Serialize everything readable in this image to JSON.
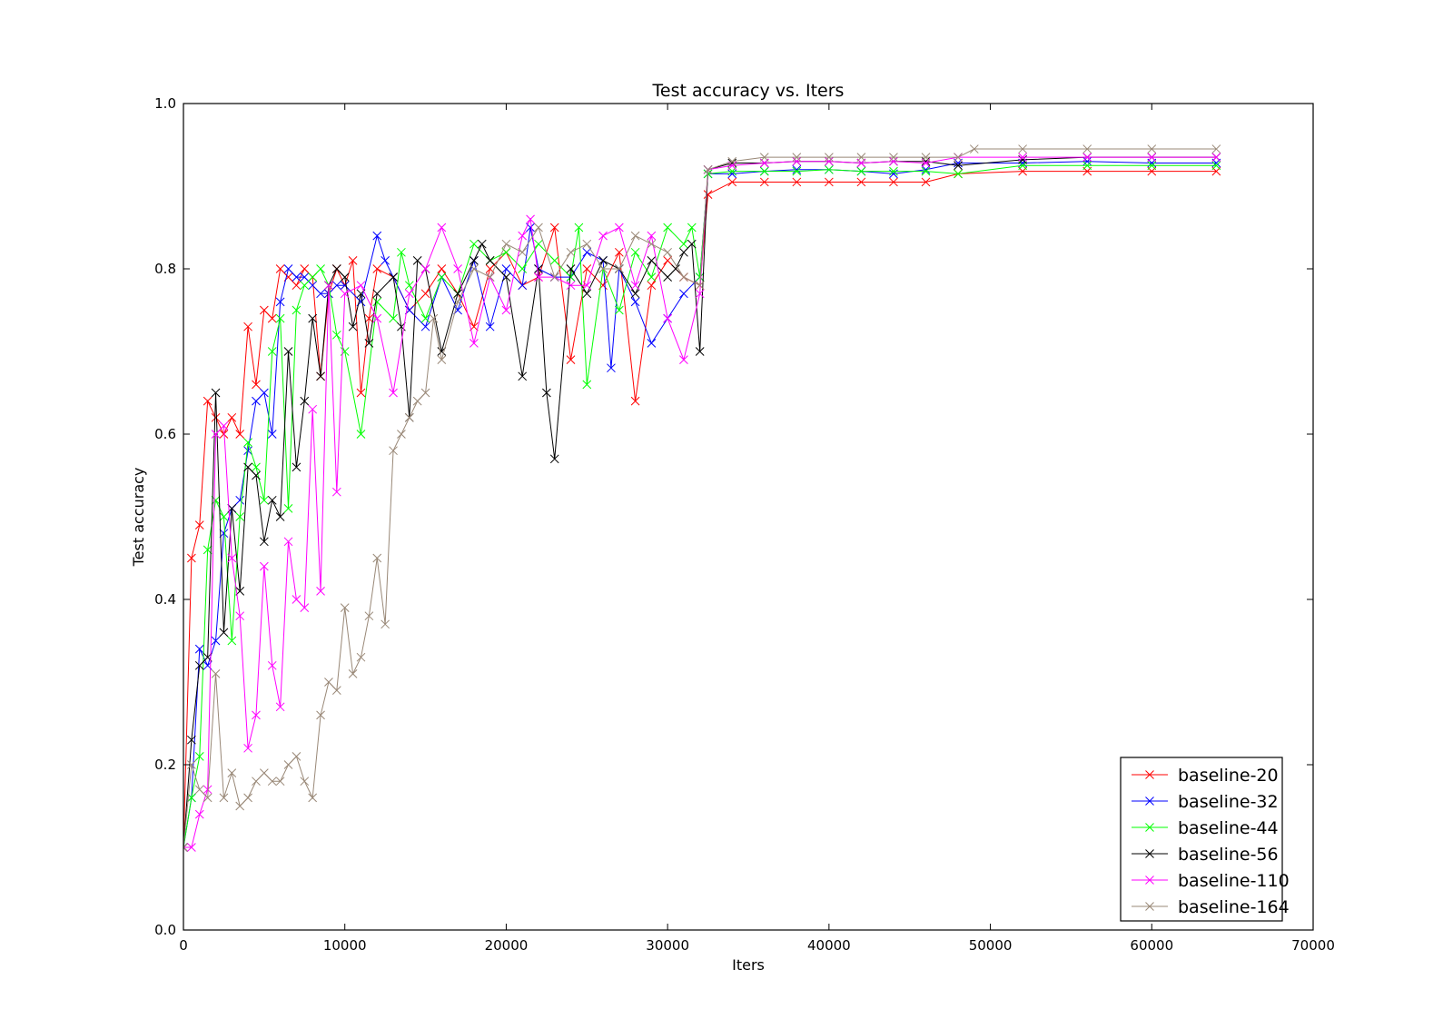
{
  "chart_data": {
    "type": "line",
    "title": "Test accuracy  vs. Iters",
    "xlabel": "Iters",
    "ylabel": "Test accuracy",
    "xlim": [
      0,
      70000
    ],
    "ylim": [
      0.0,
      1.0
    ],
    "xticks": [
      0,
      10000,
      20000,
      30000,
      40000,
      50000,
      60000,
      70000
    ],
    "xtick_labels": [
      "0",
      "10000",
      "20000",
      "30000",
      "40000",
      "50000",
      "60000",
      "70000"
    ],
    "yticks": [
      0.0,
      0.2,
      0.4,
      0.6,
      0.8,
      1.0
    ],
    "ytick_labels": [
      "0.0",
      "0.2",
      "0.4",
      "0.6",
      "0.8",
      "1.0"
    ],
    "grid": false,
    "legend_position": "lower-right",
    "marker": "x",
    "series": [
      {
        "name": "baseline-20",
        "color": "#ff0000",
        "x": [
          0,
          500,
          1000,
          1500,
          2000,
          2500,
          3000,
          3500,
          4000,
          4500,
          5000,
          5500,
          6000,
          6500,
          7000,
          7500,
          8000,
          8500,
          9000,
          9500,
          10000,
          10500,
          11000,
          11500,
          12000,
          13000,
          14000,
          15000,
          16000,
          17000,
          18000,
          19000,
          20000,
          21000,
          22000,
          23000,
          24000,
          25000,
          26000,
          27000,
          28000,
          29000,
          30000,
          31000,
          32000,
          32500,
          34000,
          36000,
          38000,
          40000,
          42000,
          44000,
          46000,
          48000,
          52000,
          56000,
          60000,
          64000
        ],
        "y": [
          0.1,
          0.45,
          0.49,
          0.64,
          0.62,
          0.6,
          0.62,
          0.6,
          0.73,
          0.66,
          0.75,
          0.74,
          0.8,
          0.79,
          0.78,
          0.8,
          0.79,
          0.67,
          0.77,
          0.8,
          0.78,
          0.81,
          0.65,
          0.74,
          0.8,
          0.79,
          0.75,
          0.77,
          0.8,
          0.77,
          0.73,
          0.8,
          0.82,
          0.78,
          0.79,
          0.85,
          0.69,
          0.8,
          0.78,
          0.82,
          0.64,
          0.78,
          0.81,
          0.79,
          0.78,
          0.89,
          0.905,
          0.905,
          0.905,
          0.905,
          0.905,
          0.905,
          0.905,
          0.915,
          0.918,
          0.918,
          0.918,
          0.918
        ]
      },
      {
        "name": "baseline-32",
        "color": "#0000ff",
        "x": [
          0,
          500,
          1000,
          1500,
          2000,
          2500,
          3000,
          3500,
          4000,
          4500,
          5000,
          5500,
          6000,
          6500,
          7000,
          7500,
          8000,
          8500,
          9000,
          9500,
          10000,
          11000,
          12000,
          12500,
          13000,
          14000,
          15000,
          16000,
          17000,
          18000,
          19000,
          20000,
          21000,
          21500,
          22000,
          23000,
          24000,
          25000,
          26000,
          26500,
          27000,
          28000,
          29000,
          30000,
          31000,
          32000,
          32500,
          34000,
          36000,
          38000,
          40000,
          42000,
          44000,
          46000,
          48000,
          52000,
          56000,
          60000,
          64000
        ],
        "y": [
          0.1,
          0.16,
          0.34,
          0.32,
          0.35,
          0.48,
          0.51,
          0.52,
          0.58,
          0.64,
          0.65,
          0.6,
          0.76,
          0.8,
          0.79,
          0.79,
          0.78,
          0.77,
          0.77,
          0.78,
          0.78,
          0.76,
          0.84,
          0.81,
          0.79,
          0.75,
          0.73,
          0.79,
          0.75,
          0.81,
          0.73,
          0.8,
          0.78,
          0.85,
          0.8,
          0.79,
          0.79,
          0.82,
          0.81,
          0.68,
          0.8,
          0.76,
          0.71,
          0.74,
          0.77,
          0.79,
          0.915,
          0.915,
          0.918,
          0.92,
          0.92,
          0.918,
          0.915,
          0.92,
          0.928,
          0.928,
          0.93,
          0.928,
          0.928
        ]
      },
      {
        "name": "baseline-44",
        "color": "#00ff00",
        "x": [
          0,
          500,
          1000,
          1500,
          2000,
          2500,
          3000,
          3500,
          4000,
          4500,
          5000,
          5500,
          6000,
          6500,
          7000,
          7500,
          8000,
          8500,
          9000,
          9500,
          10000,
          11000,
          12000,
          13000,
          13500,
          14000,
          15000,
          16000,
          17000,
          18000,
          19000,
          20000,
          21000,
          22000,
          23000,
          24000,
          24500,
          25000,
          26000,
          27000,
          28000,
          29000,
          30000,
          31000,
          31500,
          32000,
          32500,
          34000,
          36000,
          38000,
          40000,
          42000,
          44000,
          46000,
          48000,
          52000,
          56000,
          60000,
          64000
        ],
        "y": [
          0.1,
          0.16,
          0.21,
          0.46,
          0.52,
          0.5,
          0.35,
          0.5,
          0.59,
          0.56,
          0.52,
          0.7,
          0.74,
          0.51,
          0.75,
          0.78,
          0.79,
          0.8,
          0.78,
          0.72,
          0.7,
          0.6,
          0.76,
          0.74,
          0.82,
          0.78,
          0.74,
          0.79,
          0.77,
          0.83,
          0.81,
          0.82,
          0.8,
          0.83,
          0.81,
          0.79,
          0.85,
          0.66,
          0.8,
          0.75,
          0.82,
          0.79,
          0.85,
          0.83,
          0.85,
          0.79,
          0.915,
          0.918,
          0.918,
          0.918,
          0.92,
          0.918,
          0.918,
          0.918,
          0.915,
          0.925,
          0.925,
          0.925,
          0.925
        ]
      },
      {
        "name": "baseline-56",
        "color": "#000000",
        "x": [
          0,
          500,
          1000,
          1500,
          2000,
          2500,
          3000,
          3500,
          4000,
          4500,
          5000,
          5500,
          6000,
          6500,
          7000,
          7500,
          8000,
          8500,
          9000,
          9500,
          10000,
          10500,
          11000,
          11500,
          12000,
          13000,
          13500,
          14000,
          14500,
          15000,
          16000,
          17000,
          18000,
          18500,
          19000,
          20000,
          21000,
          22000,
          22500,
          23000,
          24000,
          25000,
          26000,
          27000,
          28000,
          29000,
          30000,
          30500,
          31000,
          31500,
          32000,
          32500,
          34000,
          36000,
          38000,
          40000,
          42000,
          44000,
          46000,
          48000,
          52000,
          56000,
          60000,
          64000
        ],
        "y": [
          0.1,
          0.23,
          0.32,
          0.33,
          0.65,
          0.36,
          0.51,
          0.41,
          0.56,
          0.55,
          0.47,
          0.52,
          0.5,
          0.7,
          0.56,
          0.64,
          0.74,
          0.67,
          0.78,
          0.8,
          0.79,
          0.73,
          0.77,
          0.71,
          0.77,
          0.79,
          0.73,
          0.62,
          0.81,
          0.8,
          0.7,
          0.77,
          0.81,
          0.83,
          0.81,
          0.79,
          0.67,
          0.8,
          0.65,
          0.57,
          0.8,
          0.77,
          0.81,
          0.8,
          0.77,
          0.81,
          0.79,
          0.8,
          0.82,
          0.83,
          0.7,
          0.92,
          0.928,
          0.928,
          0.93,
          0.93,
          0.928,
          0.93,
          0.93,
          0.925,
          0.932,
          0.935,
          0.935,
          0.935
        ]
      },
      {
        "name": "baseline-110",
        "color": "#ff00ff",
        "x": [
          0,
          500,
          1000,
          1500,
          2000,
          2500,
          3000,
          3500,
          4000,
          4500,
          5000,
          5500,
          6000,
          6500,
          7000,
          7500,
          8000,
          8500,
          9000,
          9500,
          10000,
          11000,
          12000,
          13000,
          14000,
          15000,
          16000,
          17000,
          18000,
          19000,
          20000,
          21000,
          21500,
          22000,
          23000,
          24000,
          25000,
          26000,
          27000,
          28000,
          29000,
          30000,
          31000,
          32000,
          32500,
          34000,
          36000,
          38000,
          40000,
          42000,
          44000,
          46000,
          48000,
          52000,
          56000,
          60000,
          64000
        ],
        "y": [
          0.1,
          0.1,
          0.14,
          0.17,
          0.6,
          0.61,
          0.45,
          0.38,
          0.22,
          0.26,
          0.44,
          0.32,
          0.27,
          0.47,
          0.4,
          0.39,
          0.63,
          0.41,
          0.78,
          0.53,
          0.77,
          0.78,
          0.74,
          0.65,
          0.77,
          0.8,
          0.85,
          0.8,
          0.71,
          0.79,
          0.75,
          0.84,
          0.86,
          0.79,
          0.79,
          0.78,
          0.78,
          0.84,
          0.85,
          0.78,
          0.84,
          0.74,
          0.69,
          0.77,
          0.92,
          0.925,
          0.928,
          0.93,
          0.93,
          0.928,
          0.93,
          0.928,
          0.935,
          0.935,
          0.935,
          0.935,
          0.935
        ]
      },
      {
        "name": "baseline-164",
        "color": "#998877",
        "x": [
          0,
          500,
          1000,
          1500,
          2000,
          2500,
          3000,
          3500,
          4000,
          4500,
          5000,
          5500,
          6000,
          6500,
          7000,
          7500,
          8000,
          8500,
          9000,
          9500,
          10000,
          10500,
          11000,
          11500,
          12000,
          12500,
          13000,
          13500,
          14000,
          14500,
          15000,
          15500,
          16000,
          17000,
          18000,
          19000,
          20000,
          21000,
          22000,
          23000,
          24000,
          25000,
          26000,
          27000,
          28000,
          29000,
          30000,
          31000,
          32000,
          32500,
          34000,
          36000,
          38000,
          40000,
          42000,
          44000,
          46000,
          48000,
          49000,
          52000,
          56000,
          60000,
          64000
        ],
        "y": [
          0.1,
          0.2,
          0.17,
          0.16,
          0.31,
          0.16,
          0.19,
          0.15,
          0.16,
          0.18,
          0.19,
          0.18,
          0.18,
          0.2,
          0.21,
          0.18,
          0.16,
          0.26,
          0.3,
          0.29,
          0.39,
          0.31,
          0.33,
          0.38,
          0.45,
          0.37,
          0.58,
          0.6,
          0.62,
          0.64,
          0.65,
          0.74,
          0.69,
          0.76,
          0.8,
          0.79,
          0.83,
          0.82,
          0.85,
          0.79,
          0.82,
          0.83,
          0.8,
          0.8,
          0.84,
          0.83,
          0.82,
          0.79,
          0.78,
          0.92,
          0.93,
          0.935,
          0.935,
          0.935,
          0.935,
          0.935,
          0.935,
          0.935,
          0.945,
          0.945,
          0.945,
          0.945,
          0.945
        ]
      }
    ]
  }
}
